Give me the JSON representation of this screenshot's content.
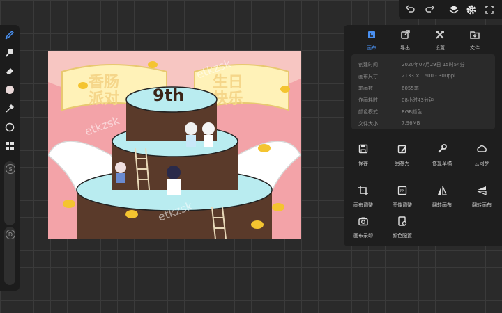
{
  "toolbar_left": {
    "tools": [
      "brush-icon",
      "smudge-icon",
      "eraser-icon",
      "color-swatch",
      "eyedropper-icon",
      "selection-icon",
      "layers-grid-icon"
    ],
    "size_slider_label": "S",
    "opacity_slider_label": "D",
    "active_color": "#e9d8d8"
  },
  "toolbar_top": {
    "icons": [
      "undo-icon",
      "redo-icon",
      "layers-icon",
      "gear-icon",
      "fullscreen-icon"
    ]
  },
  "canvas": {
    "watermark": "etkzsk",
    "cake_text": "9th",
    "banner_left": "香肠派对",
    "banner_right": "生日快乐"
  },
  "panel": {
    "tabs": [
      {
        "label": "画布",
        "icon": "canvas-info-icon",
        "active": true
      },
      {
        "label": "导出",
        "icon": "export-icon",
        "active": false
      },
      {
        "label": "设置",
        "icon": "settings-icon",
        "active": false
      },
      {
        "label": "文件",
        "icon": "folder-icon",
        "active": false
      }
    ],
    "info": [
      {
        "key": "创建时间",
        "value": "2020年07月29日 15时54分"
      },
      {
        "key": "画布尺寸",
        "value": "2133 × 1600 - 300ppi"
      },
      {
        "key": "笔画数",
        "value": "6055笔"
      },
      {
        "key": "作画耗时",
        "value": "08小时43分钟"
      },
      {
        "key": "颜色模式",
        "value": "RGB颜色"
      },
      {
        "key": "文件大小",
        "value": "7.96MB"
      }
    ],
    "actions_row1": [
      {
        "label": "保存",
        "icon": "save-icon"
      },
      {
        "label": "另存为",
        "icon": "save-as-icon"
      },
      {
        "label": "修复草稿",
        "icon": "wrench-icon"
      },
      {
        "label": "云同步",
        "icon": "cloud-sync-icon"
      }
    ],
    "actions_row2": [
      {
        "label": "画布调整",
        "icon": "crop-icon"
      },
      {
        "label": "图像调整",
        "icon": "ppi-icon"
      },
      {
        "label": "翻转画布",
        "icon": "flip-horizontal-icon"
      },
      {
        "label": "翻转画布",
        "icon": "flip-vertical-icon"
      }
    ],
    "actions_row3": [
      {
        "label": "画布录印",
        "icon": "camera-icon"
      },
      {
        "label": "颜色配置",
        "icon": "color-profile-icon"
      }
    ]
  },
  "colors": {
    "accent": "#4a90f0",
    "panel_bg": "#1e1e1e",
    "canvas_pink": "#f3a3a8",
    "cake_blue": "#b9ecf0",
    "chocolate": "#5a3a2a"
  }
}
